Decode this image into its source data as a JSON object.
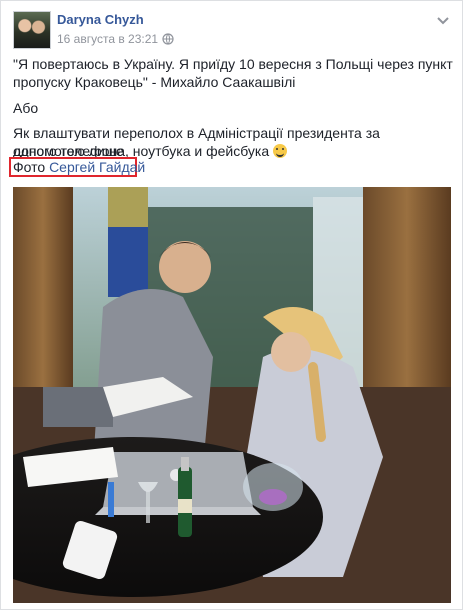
{
  "post": {
    "author": "Daryna Chyzh",
    "timestamp": "16 августа в 23:21",
    "privacy_icon": "globe-icon",
    "menu_icon": "chevron-down-icon",
    "line1": "\"Я повертаюсь в Україну. Я приїду 10 вересня з Польщі через пункт",
    "line2": "пропуску Краковець\" - Михайло Саакашвілі",
    "line3": "Або",
    "line4": "Як влаштувати переполох в Адміністрації президента за допомогою лише",
    "line5": "одного телефона, ноутбука и фейсбука",
    "emoji": "grinning-face-emoji",
    "credit_prefix": "Фото",
    "credit_name": "Сергей Гайдай",
    "highlight_color": "#e0262d",
    "link_color": "#365899"
  }
}
